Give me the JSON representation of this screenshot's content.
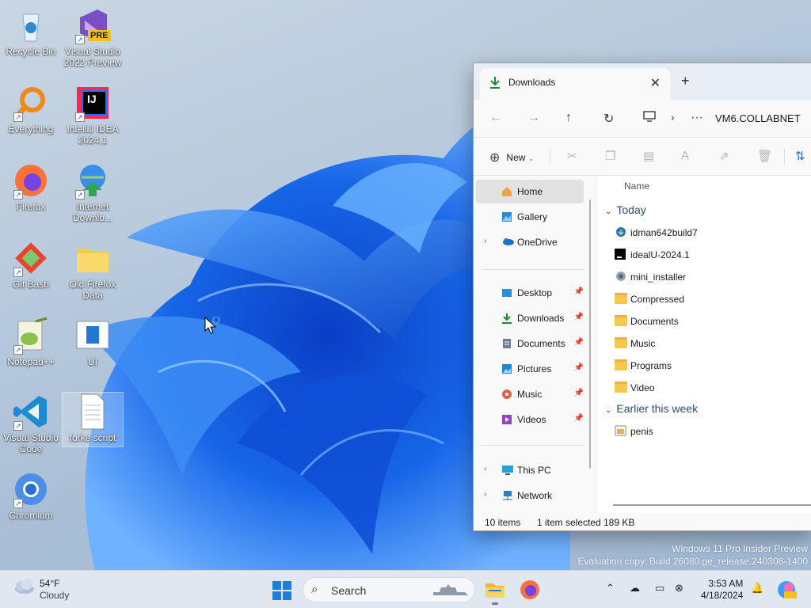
{
  "desktop": {
    "icons": [
      {
        "label": "Recycle Bin"
      },
      {
        "label": "Visual Studio 2022 Preview",
        "badge": "PRE"
      },
      {
        "label": "Everything"
      },
      {
        "label": "IntelliJ IDEA 2024.1",
        "glyph": "IJ"
      },
      {
        "label": "Firefox"
      },
      {
        "label": "Internet Downlo..."
      },
      {
        "label": "Git Bash"
      },
      {
        "label": "Old Firefox Data"
      },
      {
        "label": "Notepad++"
      },
      {
        "label": "UI"
      },
      {
        "label": "Visual Studio Code"
      },
      {
        "label": "forke script"
      },
      {
        "label": "Chromium"
      }
    ]
  },
  "explorer": {
    "tab_title": "Downloads",
    "new_tab": "+",
    "close_tab": "✕",
    "breadcrumb": "VM6.COLLABNET",
    "more": "···",
    "new_label": "New",
    "nav": {
      "home": "Home",
      "gallery": "Gallery",
      "onedrive": "OneDrive",
      "desktop": "Desktop",
      "downloads": "Downloads",
      "documents": "Documents",
      "pictures": "Pictures",
      "music": "Music",
      "videos": "Videos",
      "thispc": "This PC",
      "network": "Network"
    },
    "column_name": "Name",
    "groups": {
      "today": "Today",
      "earlier": "Earlier this week"
    },
    "files_today": [
      {
        "name": "idman642build7",
        "icon": "installer-icon"
      },
      {
        "name": "idealU-2024.1",
        "icon": "intellij-icon"
      },
      {
        "name": "mini_installer",
        "icon": "installer-icon"
      },
      {
        "name": "Compressed",
        "icon": "folder-icon"
      },
      {
        "name": "Documents",
        "icon": "folder-icon"
      },
      {
        "name": "Music",
        "icon": "folder-icon"
      },
      {
        "name": "Programs",
        "icon": "folder-icon"
      },
      {
        "name": "Video",
        "icon": "folder-icon"
      }
    ],
    "files_earlier": [
      {
        "name": "penis",
        "icon": "file-icon"
      }
    ],
    "status": {
      "count": "10 items",
      "selected": "1 item selected",
      "size": "189 KB"
    }
  },
  "watermark": {
    "line1": "Windows 11 Pro Insider Preview",
    "line2": "Evaluation copy. Build 26080.ge_release.240308-1400"
  },
  "taskbar": {
    "weather_temp": "54°F",
    "weather_cond": "Cloudy",
    "search_label": "Search",
    "time": "3:53 AM",
    "date": "4/18/2024"
  },
  "colors": {
    "accent": "#0067c0",
    "folder": "#f6c84c",
    "wallpaper_blue": "#1a5fe0"
  }
}
